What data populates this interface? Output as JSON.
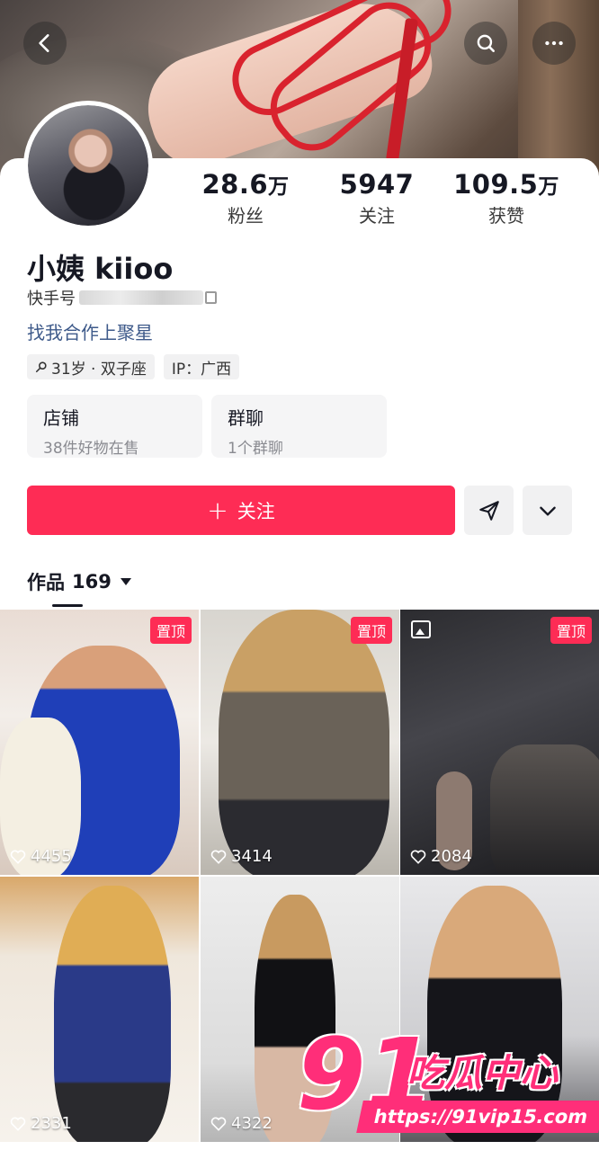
{
  "header": {
    "back_icon": "back-arrow-icon",
    "search_icon": "search-icon",
    "more_icon": "more-dots-icon"
  },
  "profile": {
    "name": "小姨 kiioo",
    "kuaishou_id_label": "快手号",
    "cooperation_link": "找我合作上聚星",
    "tags": [
      {
        "icon": "search-small-icon",
        "text": "31岁 · 双子座"
      },
      {
        "text": "IP：广西"
      }
    ]
  },
  "stats": [
    {
      "num": "28.6",
      "unit": "万",
      "label": "粉丝"
    },
    {
      "num": "5947",
      "unit": "",
      "label": "关注"
    },
    {
      "num": "109.5",
      "unit": "万",
      "label": "获赞"
    }
  ],
  "boxes": [
    {
      "title": "店铺",
      "sub": "38件好物在售"
    },
    {
      "title": "群聊",
      "sub": "1个群聊"
    }
  ],
  "actions": {
    "follow_label": "关注",
    "share_icon": "send-icon",
    "dropdown_icon": "chevron-down-icon"
  },
  "works": {
    "label": "作品",
    "count": "169"
  },
  "grid": [
    {
      "pinned": "置顶",
      "likes": "4455"
    },
    {
      "pinned": "置顶",
      "likes": "3414"
    },
    {
      "pinned": "置顶",
      "likes": "2084",
      "image_badge": true
    },
    {
      "likes": "2331"
    },
    {
      "likes": "4322"
    },
    {
      "likes": ""
    }
  ],
  "watermark": {
    "big": "91",
    "cn": "吃瓜中心",
    "url": "https://91vip15.com"
  },
  "colors": {
    "accent": "#fe2c55",
    "link": "#3e5a8a"
  }
}
